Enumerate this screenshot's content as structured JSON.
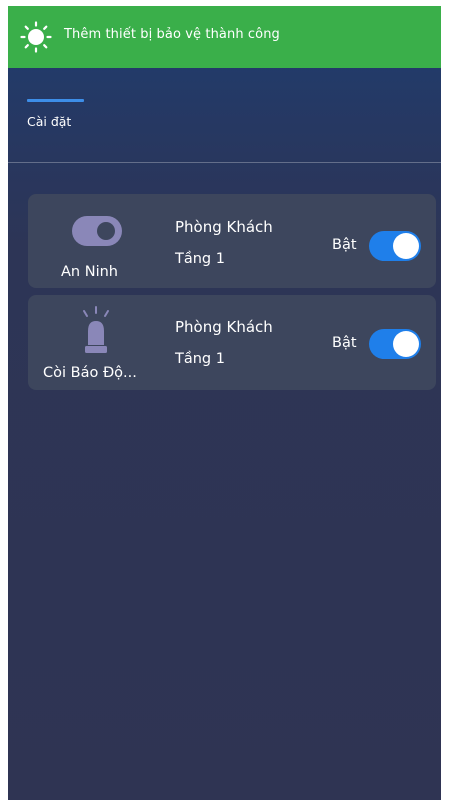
{
  "toast": {
    "icon": "sun-icon",
    "message": "Thêm thiết bị bảo vệ thành công",
    "color": "#3aaf4a"
  },
  "tabs": {
    "active": "Cài đặt",
    "accent": "#3d8ee8"
  },
  "devices": [
    {
      "icon": "toggle-switch-icon",
      "name": "An Ninh",
      "room": "Phòng Khách",
      "floor": "Tầng 1",
      "state_label": "Bật",
      "enabled": true
    },
    {
      "icon": "siren-icon",
      "name": "Còi Báo Độ...",
      "room": "Phòng Khách",
      "floor": "Tầng 1",
      "state_label": "Bật",
      "enabled": true
    }
  ],
  "switch_color": "#1f7fea"
}
